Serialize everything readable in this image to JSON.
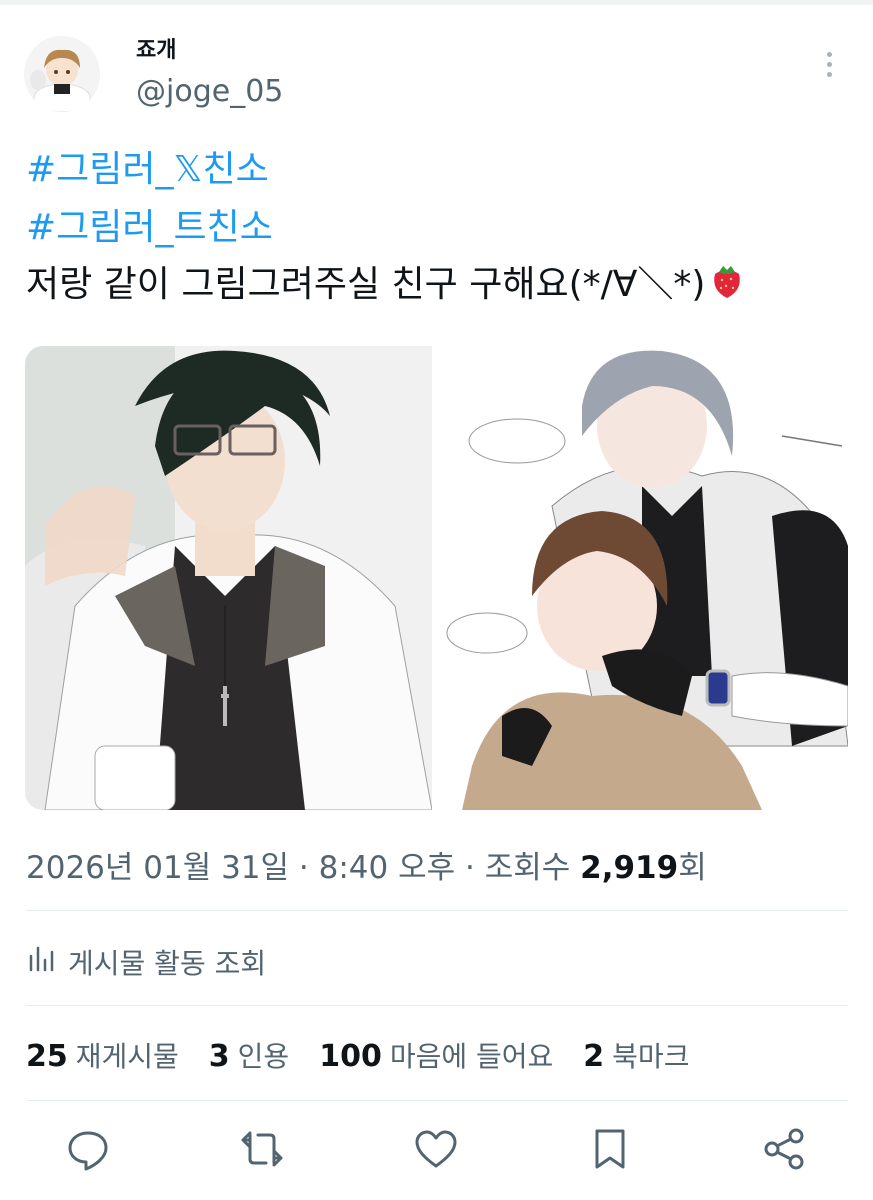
{
  "author": {
    "display_name": "죠개",
    "handle": "@joge_05"
  },
  "tweet": {
    "hashtags": [
      "#그림러_𝕏친소",
      "#그림러_트친소"
    ],
    "text": "저랑 같이 그림그려주실 친구 구해요(*/∀＼*)"
  },
  "timestamp": {
    "date": "2026년 01월 31일",
    "sep1": " · ",
    "time": "8:40 오후",
    "sep2": " · ",
    "views_label": "조회수 ",
    "views_count": "2,919",
    "views_suffix": "회"
  },
  "activity_label": "게시물 활동 조회",
  "stats": [
    {
      "count": "25",
      "label": "재게시물"
    },
    {
      "count": "3",
      "label": "인용"
    },
    {
      "count": "100",
      "label": "마음에 들어요"
    },
    {
      "count": "2",
      "label": "북마크"
    }
  ],
  "icons": [
    "more-icon",
    "bar-chart-icon",
    "reply-icon",
    "retweet-icon",
    "like-icon",
    "bookmark-icon",
    "share-icon",
    "strawberry-emoji-icon"
  ],
  "colors": {
    "link": "#1d9bf0",
    "secondary_text": "#536471",
    "primary_text": "#0f1419"
  }
}
